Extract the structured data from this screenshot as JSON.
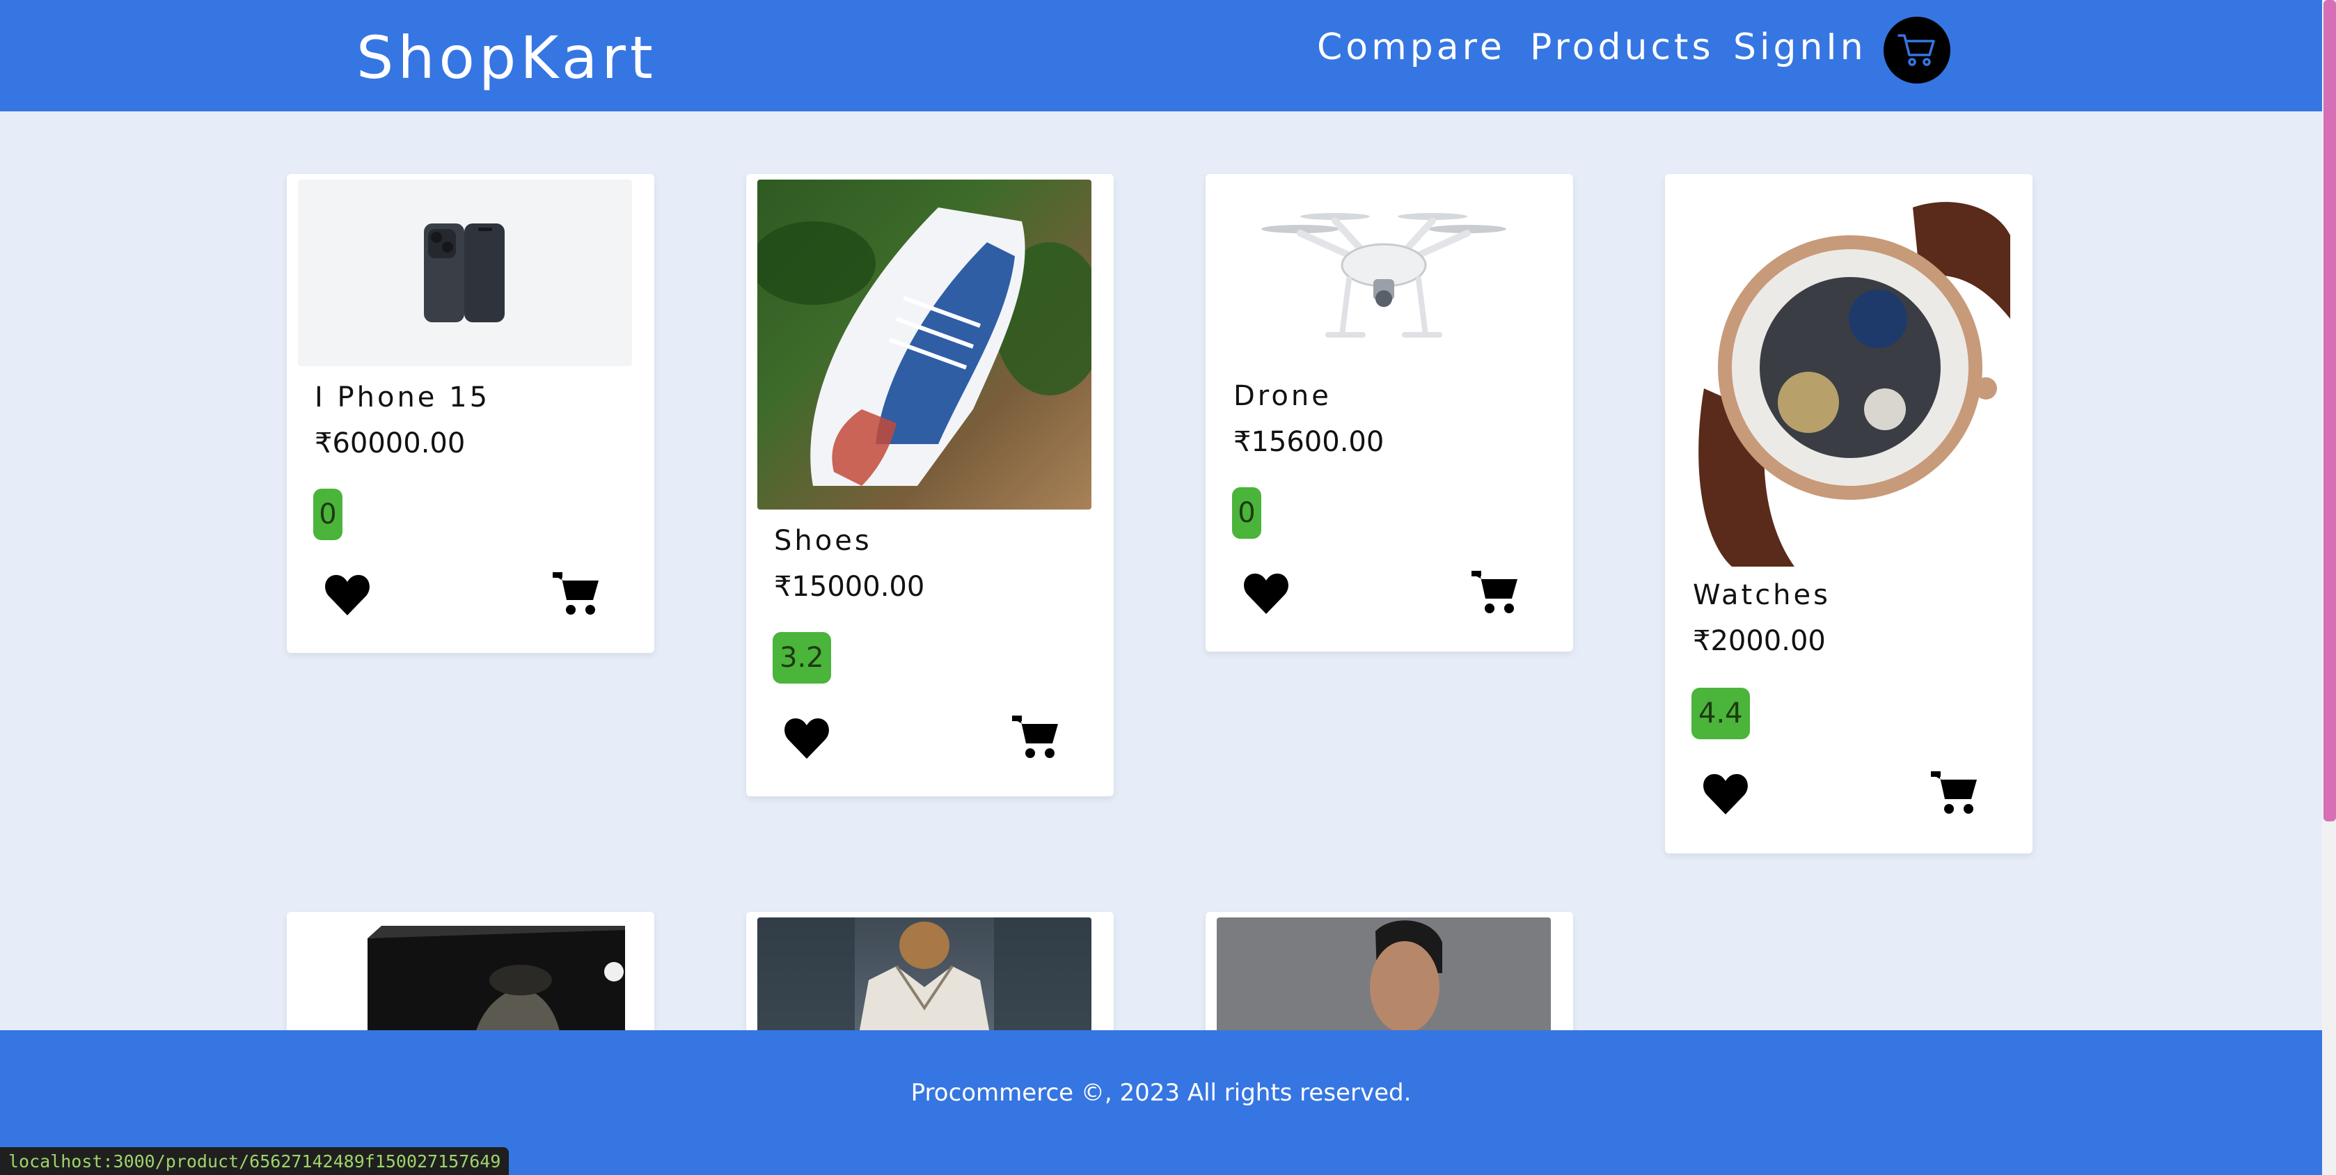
{
  "header": {
    "brand": "ShopKart",
    "nav": {
      "compare": "Compare",
      "products": "Products",
      "signin": "SignIn"
    },
    "cart_icon": "cart-icon",
    "bg_color": "#3676e2"
  },
  "products": [
    {
      "name": "I Phone 15",
      "price": "₹60000.00",
      "rating": "0",
      "image": "iphone-image"
    },
    {
      "name": "Shoes",
      "price": "₹15000.00",
      "rating": "3.2",
      "image": "shoes-image"
    },
    {
      "name": "Drone",
      "price": "₹15600.00",
      "rating": "0",
      "image": "drone-image"
    },
    {
      "name": "Watches",
      "price": "₹2000.00",
      "rating": "4.4",
      "image": "watch-image"
    }
  ],
  "partial_products": [
    {
      "image": "game-box-image"
    },
    {
      "image": "shirt-image"
    },
    {
      "image": "person-image"
    }
  ],
  "footer": {
    "text": "Procommerce ©, 2023 All rights reserved."
  },
  "status_bar": {
    "url": "localhost:3000/product/65627142489f150027157649"
  },
  "colors": {
    "accent": "#3676e2",
    "rating_bg": "#4bb43a",
    "page_bg": "#e6edf8"
  }
}
